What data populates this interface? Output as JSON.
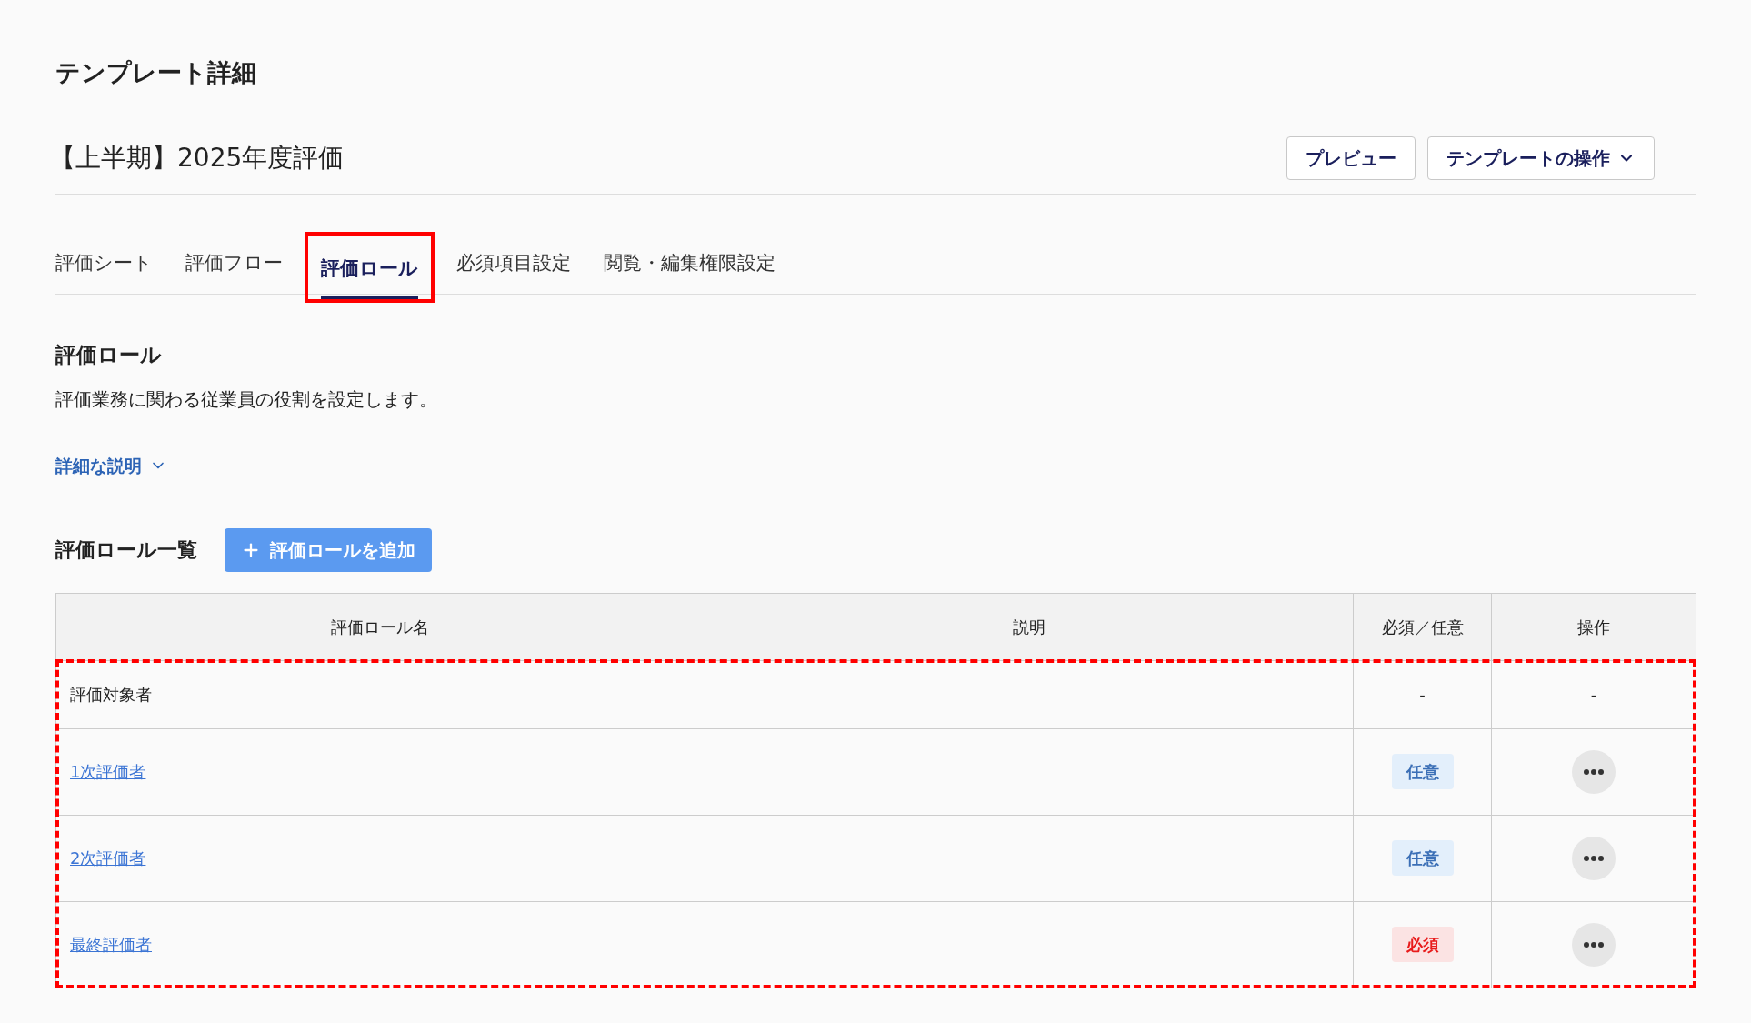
{
  "page_title": "テンプレート詳細",
  "template": {
    "name": "【上半期】2025年度評価",
    "buttons": [
      {
        "label": "プレビュー",
        "kind": "plain"
      },
      {
        "label": "テンプレートの操作",
        "kind": "dropdown"
      }
    ]
  },
  "tabs": [
    {
      "label": "評価シート",
      "selected": false,
      "highlighted": false
    },
    {
      "label": "評価フロー",
      "selected": false,
      "highlighted": false
    },
    {
      "label": "評価ロール",
      "selected": true,
      "highlighted": true
    },
    {
      "label": "必須項目設定",
      "selected": false,
      "highlighted": false
    },
    {
      "label": "閲覧・編集権限設定",
      "selected": false,
      "highlighted": false
    }
  ],
  "section": {
    "title": "評価ロール",
    "description": "評価業務に関わる従業員の役割を設定します。",
    "details_toggle": {
      "label": "詳細な説明",
      "expanded": false
    }
  },
  "list": {
    "title": "評価ロール一覧",
    "add_button": "評価ロールを追加"
  },
  "table": {
    "columns": [
      "評価ロール名",
      "説明",
      "必須／任意",
      "操作"
    ],
    "rows_highlighted": true,
    "rows": [
      {
        "name": "評価対象者",
        "kind": "plain",
        "requirement": {
          "kind": "none",
          "label": "-"
        },
        "action": {
          "kind": "none",
          "label": "-"
        }
      },
      {
        "name": "1次評価者",
        "kind": "link",
        "requirement": {
          "kind": "optional",
          "label": "任意"
        },
        "action": {
          "kind": "menu"
        }
      },
      {
        "name": "2次評価者",
        "kind": "link",
        "requirement": {
          "kind": "optional",
          "label": "任意"
        },
        "action": {
          "kind": "menu"
        }
      },
      {
        "name": "最終評価者",
        "kind": "link",
        "requirement": {
          "kind": "required",
          "label": "必須"
        },
        "action": {
          "kind": "menu"
        }
      }
    ]
  }
}
